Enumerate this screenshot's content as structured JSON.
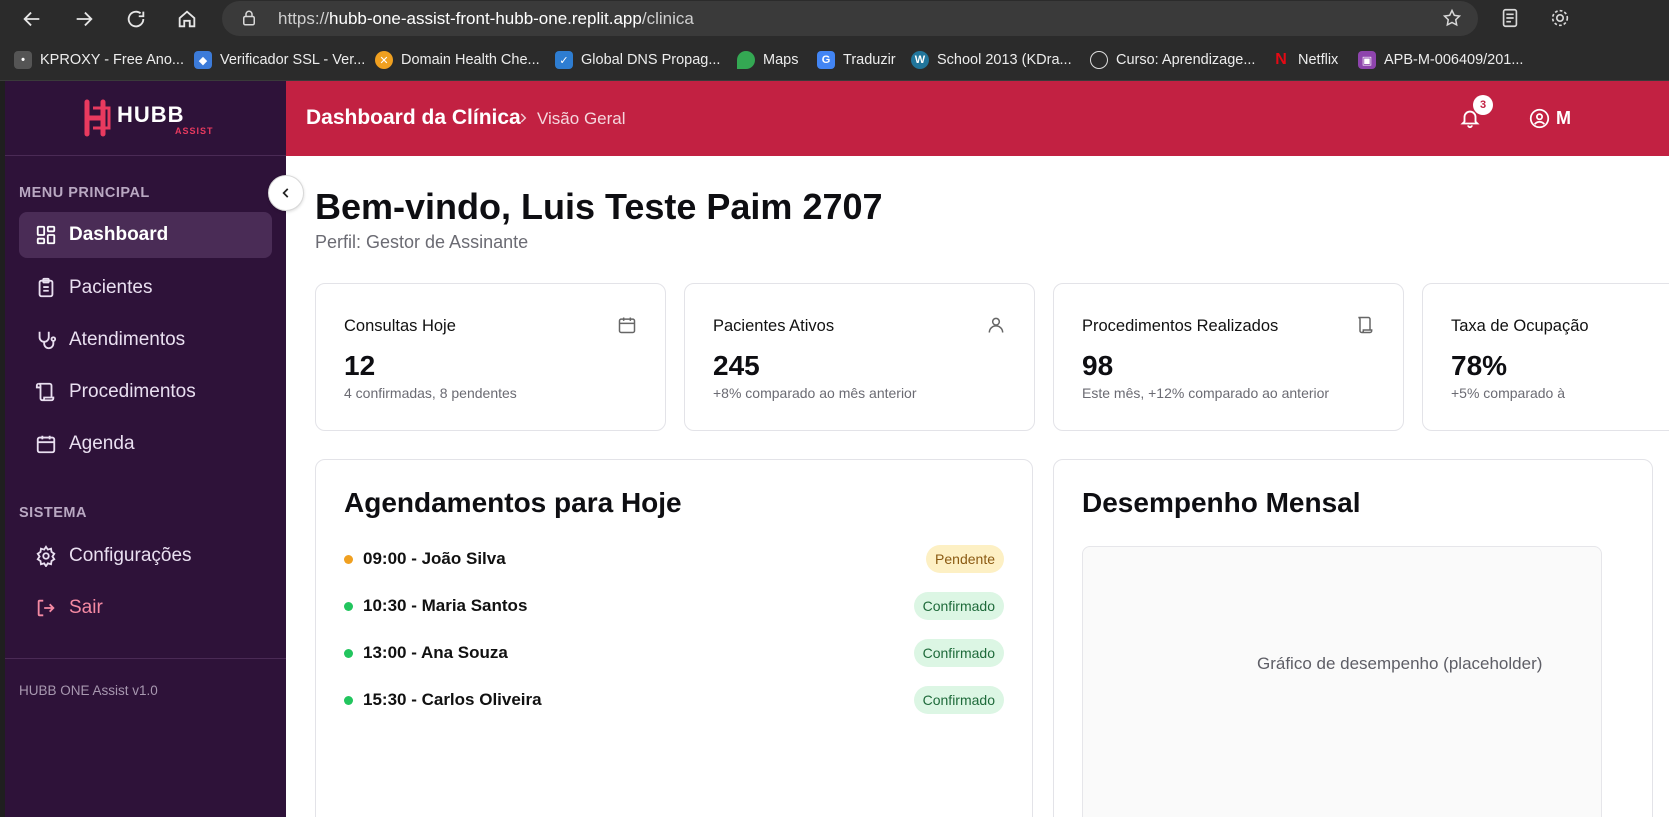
{
  "browser": {
    "url_scheme": "https://",
    "url_host": "hubb-one-assist-front-hubb-one.replit.app",
    "url_path": "/clinica",
    "bookmarks": [
      {
        "label": "KPROXY - Free Ano...",
        "color": "#555555",
        "icon": "kproxy-icon"
      },
      {
        "label": "Verificador SSL - Ver...",
        "color": "#3c7bd9",
        "icon": "ssl-icon"
      },
      {
        "label": "Domain Health Che...",
        "color": "#f0a020",
        "icon": "domain-health-icon"
      },
      {
        "label": "Global DNS Propag...",
        "color": "#2e7dd1",
        "icon": "dns-icon"
      },
      {
        "label": "Maps",
        "color": "#34a853",
        "icon": "maps-pin-icon"
      },
      {
        "label": "Traduzir",
        "color": "#4285f4",
        "icon": "translate-icon"
      },
      {
        "label": "School 2013 (KDra...",
        "color": "#21759b",
        "icon": "wordpress-icon"
      },
      {
        "label": "Curso: Aprendizage...",
        "color": "#666666",
        "icon": "globe-icon"
      },
      {
        "label": "Netflix",
        "color": "#e50914",
        "icon": "netflix-icon"
      },
      {
        "label": "APB-M-006409/201...",
        "color": "#8e44ad",
        "icon": "classroom-icon"
      }
    ]
  },
  "sidebar": {
    "brand_main": "HUBB",
    "brand_sub": "ASSIST",
    "menu_title": "MENU PRINCIPAL",
    "items": [
      {
        "label": "Dashboard",
        "icon": "dashboard-icon",
        "active": true
      },
      {
        "label": "Pacientes",
        "icon": "clipboard-icon"
      },
      {
        "label": "Atendimentos",
        "icon": "stethoscope-icon"
      },
      {
        "label": "Procedimentos",
        "icon": "scroll-icon"
      },
      {
        "label": "Agenda",
        "icon": "calendar-icon"
      }
    ],
    "system_title": "SISTEMA",
    "system_items": [
      {
        "label": "Configurações",
        "icon": "gear-icon"
      },
      {
        "label": "Sair",
        "icon": "logout-icon"
      }
    ],
    "version": "HUBB ONE Assist v1.0"
  },
  "header": {
    "title": "Dashboard da Clínica",
    "subtitle": "Visão Geral",
    "notification_count": "3",
    "user_initial": "M",
    "accent_color": "#c22142"
  },
  "main": {
    "welcome": "Bem-vindo, Luis Teste Paim 2707",
    "profile": "Perfil: Gestor de Assinante",
    "stats": [
      {
        "title": "Consultas Hoje",
        "value": "12",
        "sub": "4 confirmadas, 8 pendentes",
        "icon": "calendar-icon"
      },
      {
        "title": "Pacientes Ativos",
        "value": "245",
        "sub": "+8% comparado ao mês anterior",
        "icon": "user-icon"
      },
      {
        "title": "Procedimentos Realizados",
        "value": "98",
        "sub": "Este mês, +12% comparado ao anterior",
        "icon": "scroll-icon"
      },
      {
        "title": "Taxa de Ocupação",
        "value": "78%",
        "sub": "+5% comparado à",
        "icon": ""
      }
    ],
    "appointments": {
      "title": "Agendamentos para Hoje",
      "items": [
        {
          "text": "09:00 - João Silva",
          "status": "Pendente",
          "status_type": "pending"
        },
        {
          "text": "10:30 - Maria Santos",
          "status": "Confirmado",
          "status_type": "confirmed"
        },
        {
          "text": "13:00 - Ana Souza",
          "status": "Confirmado",
          "status_type": "confirmed"
        },
        {
          "text": "15:30 - Carlos Oliveira",
          "status": "Confirmado",
          "status_type": "confirmed"
        }
      ]
    },
    "performance": {
      "title": "Desempenho Mensal",
      "placeholder": "Gráfico de desempenho (placeholder)"
    }
  }
}
